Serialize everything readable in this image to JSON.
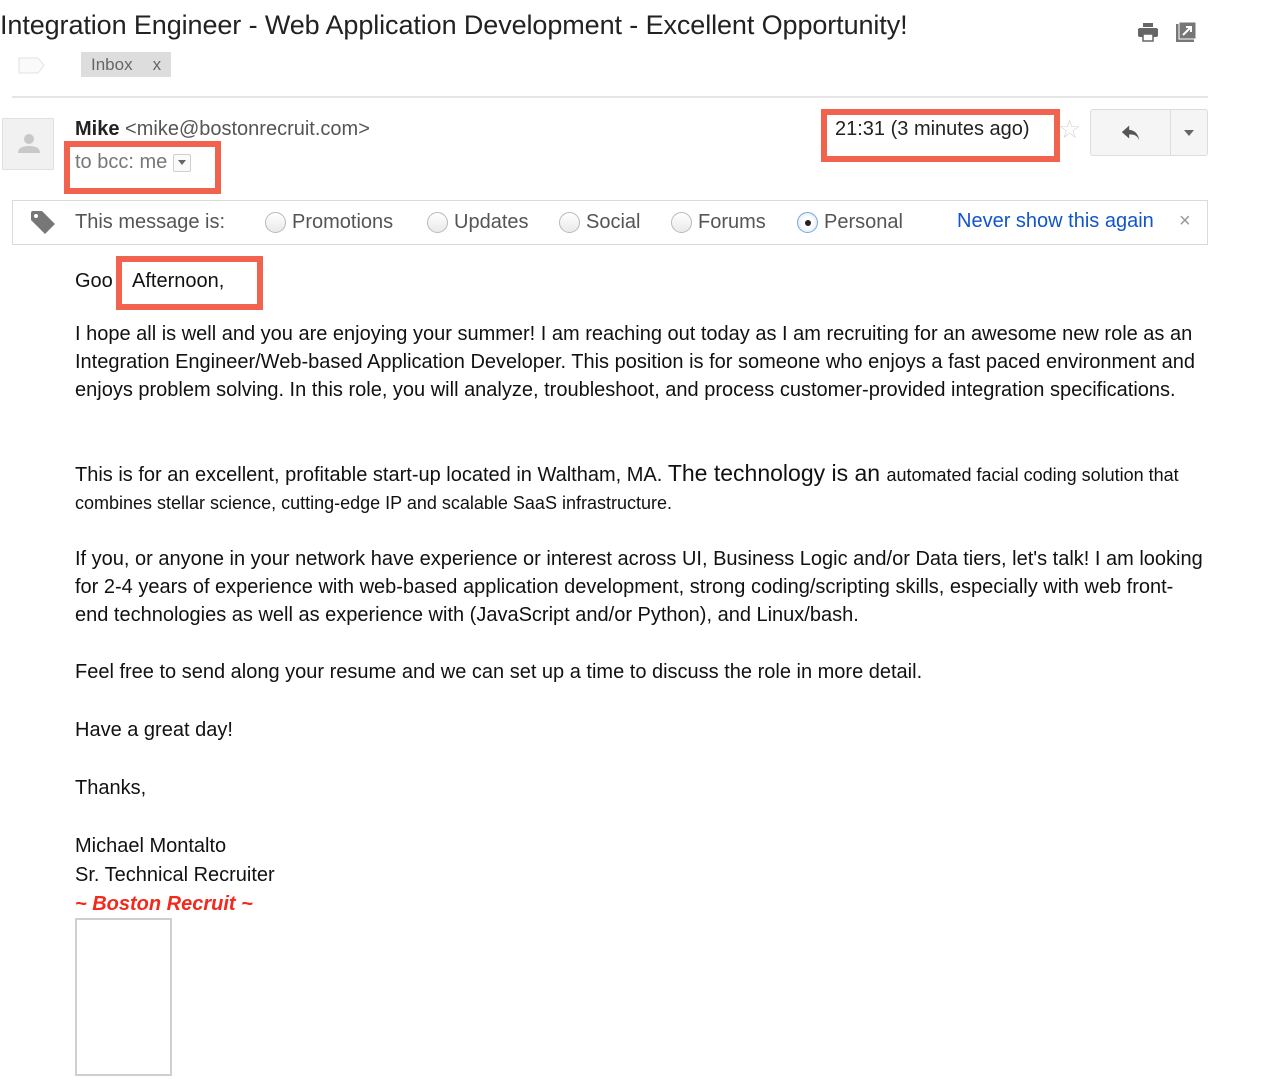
{
  "subject": "Integration Engineer - Web Application Development - Excellent Opportunity!",
  "labels": [
    {
      "name": "Inbox",
      "remove": "x"
    }
  ],
  "toolbar_icons": [
    "print-icon",
    "new-window-icon"
  ],
  "message": {
    "sender_name": "Mike",
    "sender_email": "<mike@bostonrecruit.com>",
    "recipients": "to bcc: me",
    "time": "21:31 (3 minutes ago)",
    "starred": false
  },
  "category_bar": {
    "label": "This message is:",
    "options": [
      {
        "label": "Promotions",
        "checked": false
      },
      {
        "label": "Updates",
        "checked": false
      },
      {
        "label": "Social",
        "checked": false
      },
      {
        "label": "Forums",
        "checked": false
      },
      {
        "label": "Personal",
        "checked": true
      }
    ],
    "dismiss_link": "Never show this again",
    "close": "×"
  },
  "body": {
    "greeting_prefix": "Goo",
    "greeting_highlight": "Afternoon,",
    "paragraph1": "I hope all is well and you are enjoying your summer! I am reaching out today as I am recruiting for an awesome new role as an Integration Engineer/Web-based Application Developer. This position is for someone who enjoys a fast paced environment and enjoys problem solving. In this role, you will analyze, troubleshoot, and process customer-provided integration specifications.",
    "paragraph2_a": "This is for an excellent, profitable start-up located in Waltham, MA. ",
    "paragraph2_b": "The technology is an ",
    "paragraph2_c": "automated facial coding solution that combines stellar science, cutting-edge IP and scalable SaaS infrastructure.",
    "paragraph3": "If you, or anyone in your network have experience or interest across UI, Business Logic and/or Data tiers, let's talk! I am looking for 2-4 years of experience with web-based application development, strong coding/scripting skills, especially with web front-end technologies as well as experience with (JavaScript and/or Python), and Linux/bash.",
    "paragraph4": "Feel free to send along your resume and we can set up a time to discuss the role in more detail.",
    "paragraph5": "Have a great day!",
    "paragraph6": "Thanks,",
    "signature_name": "Michael Montalto",
    "signature_title": "Sr. Technical Recruiter",
    "signature_company": "~ Boston Recruit ~"
  },
  "colors": {
    "highlight_box": "#f2634f",
    "link": "#1155cc",
    "brand_red": "#f22a1e"
  }
}
